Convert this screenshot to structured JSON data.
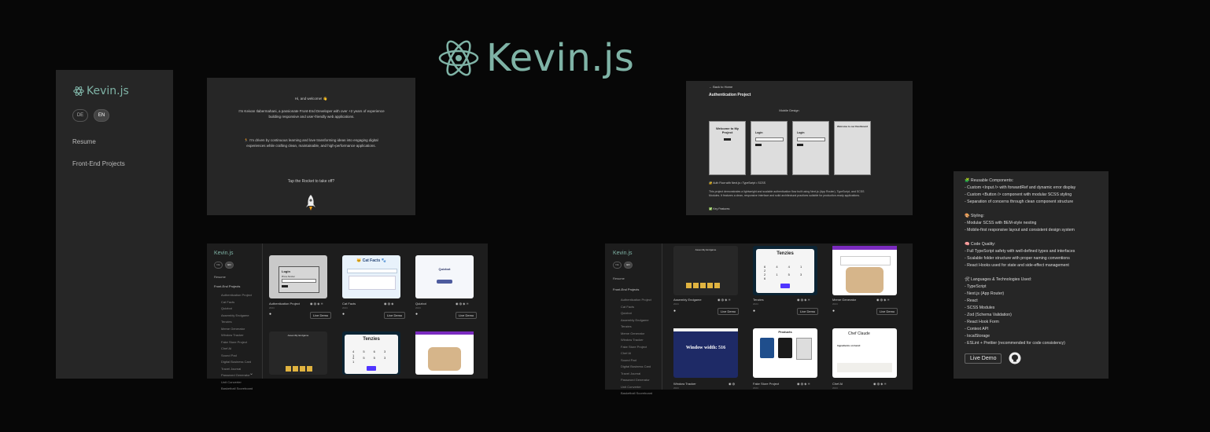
{
  "brand": {
    "name": "Kevin.js",
    "color": "#7fb3a6"
  },
  "sidebar": {
    "languages": [
      "DE",
      "EN"
    ],
    "active_language": "EN",
    "nav": [
      "Resume",
      "Front-End Projects"
    ]
  },
  "intro": {
    "greeting": "Hi, and welcome! 👋",
    "para1": "I'm Keivan Ilabermahani, a passionate Front-End Developer with over +2 years of experience building responsive and user-friendly web applications.",
    "para2": "🏃 I'm driven by continuous learning and love transforming ideas into engaging digital experiences while crafting clean, maintainable, and high-performance applications.",
    "cta": "Tap the Rocket to take off?"
  },
  "project_detail": {
    "back": "← Back to Home",
    "title": "Authentication Project",
    "mobile_design": "Mobile Design",
    "phones": [
      "Welcome to My Project",
      "Login",
      "Login",
      "Welcome to our Dashboard"
    ],
    "stack": "🔐 Auth Flow with Next.js • TypeScript • SCSS",
    "description": "This project demonstrates a lightweight and scalable authentication flow built using Next.js (App Router), TypeScript, and SCSS Modules. It features a clean, responsive interface and solid architectural practices suitable for production-ready applications.",
    "features": "✅ Key Features:"
  },
  "grid1": {
    "nav_items": [
      "Authentication Project",
      "Cat Facts",
      "Quizbot",
      "Assembly Endgame",
      "Tenzies",
      "Meme Generator",
      "Window Tracker",
      "Fake Store Project",
      "Chef AI",
      "Sound Pad",
      "Digital Business Card",
      "Travel Journal",
      "Password Generator",
      "Unit Converter",
      "Basketball Scoreboard"
    ],
    "cards": [
      {
        "title": "Authentication Project",
        "year": "2024"
      },
      {
        "title": "Cat Facts",
        "year": "2024"
      },
      {
        "title": "Quizbot",
        "year": "2024"
      }
    ],
    "live_demo": "Live Demo",
    "login_label": "Login",
    "phone_label": "Phone Number",
    "cat_title": "🐱 Cat Facts 🐾",
    "quiz_title": "Quizbot",
    "tenzies": "Tenzies",
    "assembly": "Assembly Endgame"
  },
  "grid2": {
    "nav_items": [
      "Authentication Project",
      "Cat Facts",
      "Quizbot",
      "Assembly Endgame",
      "Tenzies",
      "Meme Generator",
      "Window Tracker",
      "Fake Store Project",
      "Chef AI",
      "Sound Pad",
      "Digital Business Card",
      "Travel Journal",
      "Password Generator",
      "Unit Converter",
      "Basketball Scoreboard"
    ],
    "cards": [
      {
        "title": "Assembly Endgame",
        "year": "2024"
      },
      {
        "title": "Tenzies",
        "year": "2024"
      },
      {
        "title": "Meme Generator",
        "year": "2024"
      },
      {
        "title": "Window Tracker",
        "year": "2024"
      },
      {
        "title": "Fake Store Project",
        "year": "2024"
      },
      {
        "title": "Chef AI",
        "year": "2024"
      }
    ],
    "live_demo": "Live Demo",
    "window_width": "Window width: 516",
    "products": "Products",
    "chef": "Chef Claude",
    "ingredients": "Ingredients on hand:"
  },
  "features": {
    "sections": [
      {
        "heading": "🧩 Reusable Components:",
        "items": [
          "- Custom <Input /> with forwardRef and dynamic error display",
          "- Custom <Button /> component with modular SCSS styling",
          "- Separation of concerns through clean component structure"
        ]
      },
      {
        "heading": "🎨 Styling:",
        "items": [
          "- Modular SCSS with BEM-style nesting",
          "- Mobile-first responsive layout and consistent design system"
        ]
      },
      {
        "heading": "🧠 Code Quality:",
        "items": [
          "- Full TypeScript safety with well-defined types and interfaces",
          "- Scalable folder structure with proper naming conventions",
          "- React Hooks used for state and side-effect management"
        ]
      },
      {
        "heading": "🛠 Languages & Technologies Used:",
        "items": [
          "- TypeScript",
          "- Next.js (App Router)",
          "- React",
          "- SCSS Modules",
          "- Zod (Schema Validation)",
          "- React Hook Form",
          "- Context API",
          "- localStorage",
          "- ESLint + Prettier (recommended for code consistency)"
        ]
      }
    ],
    "live_demo": "Live Demo"
  }
}
